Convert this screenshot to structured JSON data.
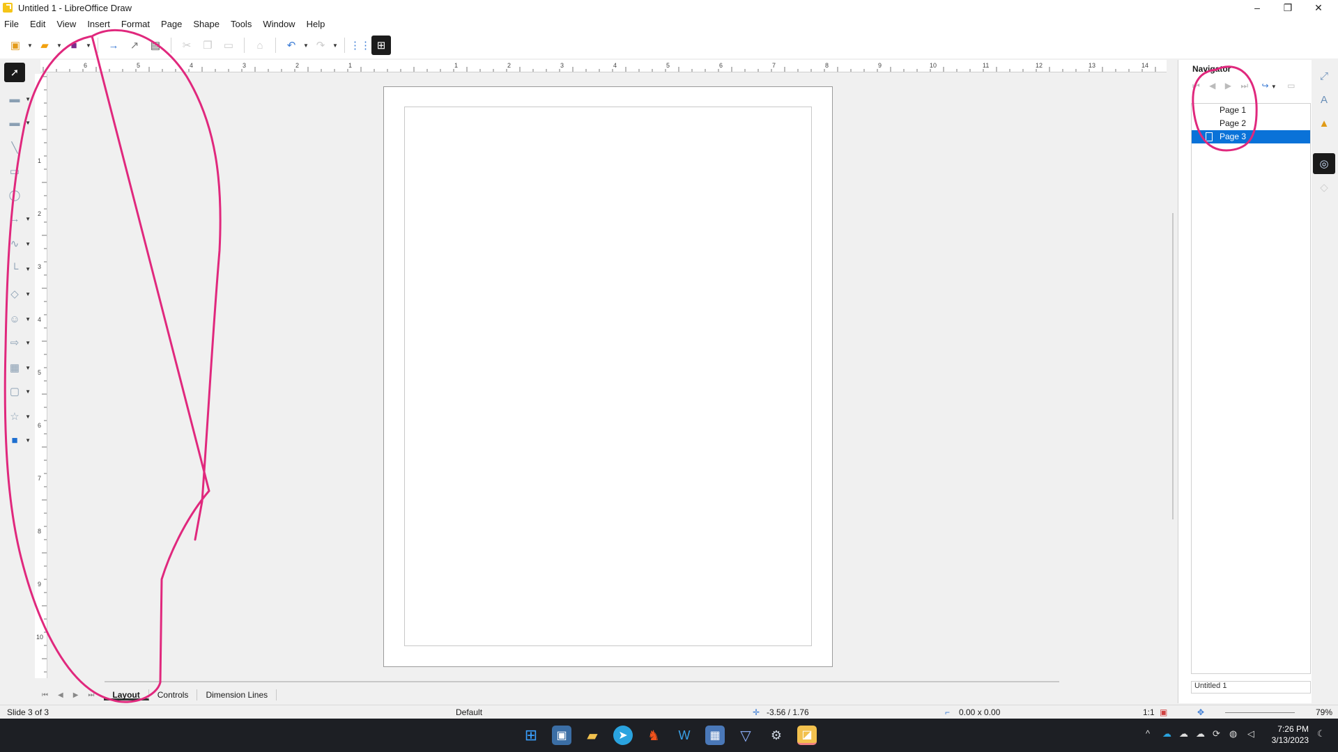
{
  "window": {
    "title": "Untitled 1 - LibreOffice Draw",
    "minimize": "–",
    "maximize": "❐",
    "close": "✕"
  },
  "menu": [
    "File",
    "Edit",
    "View",
    "Insert",
    "Format",
    "Page",
    "Shape",
    "Tools",
    "Window",
    "Help"
  ],
  "toolbar_icons": [
    "new-icon",
    "open-icon",
    "save-icon",
    "export-icon",
    "export-pdf-icon",
    "print-icon",
    "cut-icon",
    "copy-icon",
    "paste-icon",
    "clone-formatting-icon",
    "undo-icon",
    "redo-icon",
    "grid-icon",
    "helplines-icon"
  ],
  "ruler": {
    "horizontal": [
      "6",
      "5",
      "4",
      "3",
      "2",
      "1",
      "1",
      "2",
      "3",
      "4",
      "5",
      "6",
      "7",
      "8",
      "9",
      "10",
      "11",
      "12",
      "13",
      "14"
    ],
    "vertical": [
      "1",
      "2",
      "3",
      "4",
      "5",
      "6",
      "7",
      "8",
      "9",
      "10"
    ]
  },
  "tabs": {
    "items": [
      "Layout",
      "Controls",
      "Dimension Lines"
    ],
    "active": "Layout"
  },
  "status": {
    "slide": "Slide 3 of 3",
    "master": "Default",
    "position": "-3.56 / 1.76",
    "size": "0.00 x 0.00",
    "scale": "1:1",
    "zoom": "79%"
  },
  "navigator": {
    "title": "Navigator",
    "pages": [
      "Page 1",
      "Page 2",
      "Page 3"
    ],
    "selected_page": "Page 3",
    "document": "Untitled 1"
  },
  "clock": {
    "time": "7:26 PM",
    "date": "3/13/2023"
  },
  "colors": {
    "annotation": "#e0287d",
    "selection": "#0a72d8",
    "taskbar": "#1d1f24"
  }
}
